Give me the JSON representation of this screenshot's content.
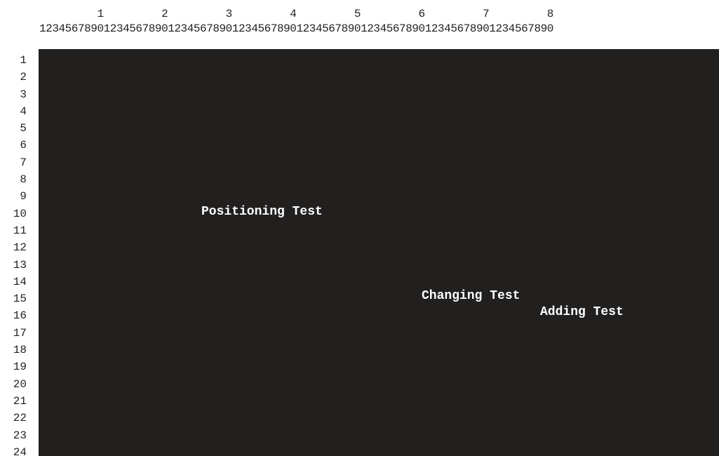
{
  "ruler": {
    "tens": "         1         2         3         4         5         6         7         8",
    "units": "12345678901234567890123456789012345678901234567890123456789012345678901234567890"
  },
  "line_numbers": [
    "1",
    "2",
    "3",
    "4",
    "5",
    "6",
    "7",
    "8",
    "9",
    "10",
    "11",
    "12",
    "13",
    "14",
    "15",
    "16",
    "17",
    "18",
    "19",
    "20",
    "21",
    "22",
    "23",
    "24"
  ],
  "screen": {
    "background_color": "#221f1f",
    "text_color": "#ffffff",
    "lines": [
      {
        "text": "Positioning Test"
      },
      {
        "text": "Changing Test"
      },
      {
        "text": "Adding Test"
      }
    ]
  }
}
